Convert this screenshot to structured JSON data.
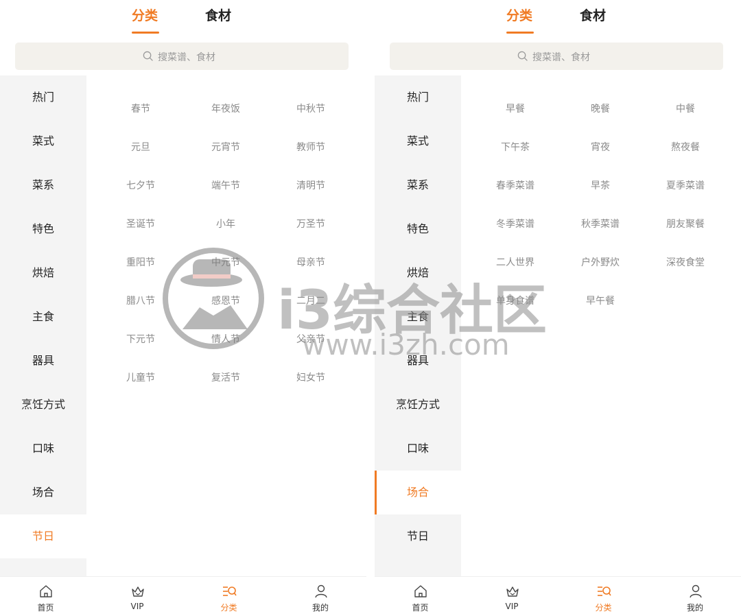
{
  "tabs": {
    "category": "分类",
    "ingredients": "食材"
  },
  "search": {
    "placeholder": "搜菜谱、食材"
  },
  "colors": {
    "accent": "#f07b24",
    "sidebar_bg": "#f4f4f4",
    "search_bg": "#f3f1ec"
  },
  "sidebar": [
    "热门",
    "菜式",
    "菜系",
    "特色",
    "烘焙",
    "主食",
    "器具",
    "烹饪方式",
    "口味",
    "场合",
    "节日"
  ],
  "left": {
    "active_category": "节日",
    "items": [
      "春节",
      "年夜饭",
      "中秋节",
      "元旦",
      "元宵节",
      "教师节",
      "七夕节",
      "端午节",
      "清明节",
      "圣诞节",
      "小年",
      "万圣节",
      "重阳节",
      "中元节",
      "母亲节",
      "腊八节",
      "感恩节",
      "二月二",
      "下元节",
      "情人节",
      "父亲节",
      "儿童节",
      "复活节",
      "妇女节"
    ]
  },
  "right": {
    "active_category": "场合",
    "items": [
      "早餐",
      "晚餐",
      "中餐",
      "下午茶",
      "宵夜",
      "熬夜餐",
      "春季菜谱",
      "早茶",
      "夏季菜谱",
      "冬季菜谱",
      "秋季菜谱",
      "朋友聚餐",
      "二人世界",
      "户外野炊",
      "深夜食堂",
      "单身食谱",
      "早午餐"
    ]
  },
  "bottom_nav": [
    {
      "label": "首页",
      "icon": "home-icon"
    },
    {
      "label": "VIP",
      "icon": "crown-icon"
    },
    {
      "label": "分类",
      "icon": "category-icon"
    },
    {
      "label": "我的",
      "icon": "user-icon"
    }
  ],
  "watermark": {
    "title": "i3综合社区",
    "url": "www.i3zh.com"
  }
}
